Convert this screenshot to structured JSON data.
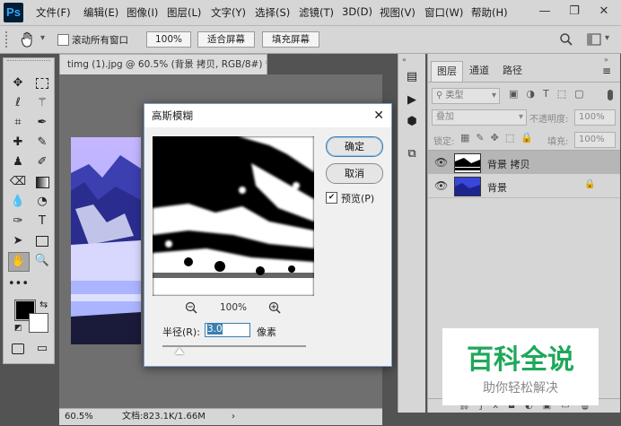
{
  "app": {
    "logo": "Ps"
  },
  "menu": [
    "文件(F)",
    "编辑(E)",
    "图像(I)",
    "图层(L)",
    "文字(Y)",
    "选择(S)",
    "滤镜(T)",
    "3D(D)",
    "视图(V)",
    "窗口(W)",
    "帮助(H)"
  ],
  "window_controls": {
    "minimize": "—",
    "restore": "❐",
    "close": "✕"
  },
  "options": {
    "scroll_all": "滚动所有窗口",
    "zoom_value": "100%",
    "fit_screen": "适合屏幕",
    "fill_screen": "填充屏幕"
  },
  "document": {
    "tab_title": "timg (1).jpg @ 60.5% (背景 拷贝, RGB/8#) *",
    "tab_close": "×"
  },
  "status": {
    "zoom": "60.5%",
    "doc_info": "文档:823.1K/1.66M"
  },
  "dialog": {
    "title": "高斯模糊",
    "ok": "确定",
    "cancel": "取消",
    "preview_label": "预览(P)",
    "preview_checked": true,
    "zoom_percent": "100%",
    "radius_label": "半径(R):",
    "radius_value": "3.0",
    "unit": "像素",
    "slider_value_fraction": 0.12
  },
  "panels": {
    "tabs": [
      "图层",
      "通道",
      "路径"
    ],
    "filter_kind": "类型",
    "blend_mode": "叠加",
    "opacity_label": "不透明度:",
    "opacity_value": "100%",
    "lock_label": "锁定:",
    "fill_label": "填充:",
    "fill_value": "100%",
    "layers": [
      {
        "name": "背景 拷贝",
        "selected": true
      },
      {
        "name": "背景",
        "locked": true
      }
    ]
  },
  "watermark": {
    "title": "百科全说",
    "subtitle": "助你轻松解决"
  },
  "colors": {
    "accent": "#31a8ff",
    "selected_layer": "#b6b6b6",
    "watermark_green": "#1fa85a"
  }
}
